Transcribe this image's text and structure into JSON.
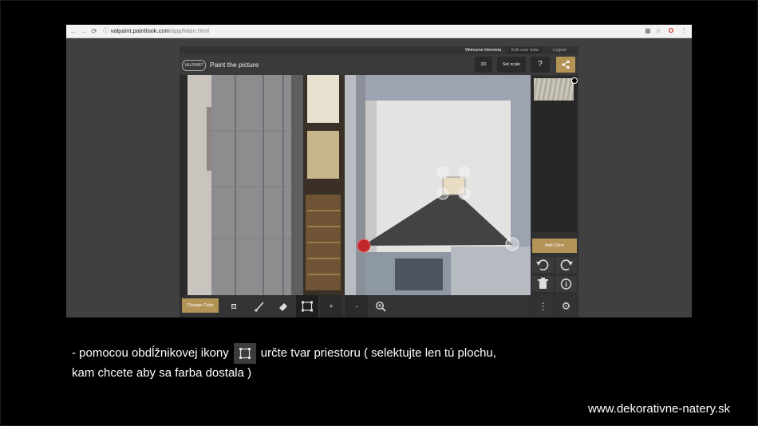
{
  "browser": {
    "url_host": "valpaint.paintlook.com",
    "url_path": "/app/Main.html"
  },
  "app": {
    "logo_text": "VALPAINT",
    "title": "Paint the picture",
    "userbar": {
      "welcome": "Welcome Henrieta",
      "edit": "Edit user data",
      "logout": "Logout"
    },
    "toolbar": {
      "btn_3d": "3D",
      "btn_scale": "Set scale",
      "btn_help": "?"
    },
    "sidebar": {
      "add_color": "Add Color"
    },
    "bottombar": {
      "change_color": "Change Color",
      "plus": "+",
      "minus": "-"
    },
    "colors": {
      "accent": "#b39356",
      "bar": "#333333",
      "selection_fill": "#3a3a3a",
      "anchor_red": "#c0282d"
    }
  },
  "caption": {
    "part1": "- pomocou obdĺžnikovej ikony",
    "part2": "určte tvar priestoru ( selektujte len tú plochu,",
    "line2": "kam chcete aby sa farba dostala )"
  },
  "footer": {
    "url": "www.dekorativne-natery.sk"
  }
}
